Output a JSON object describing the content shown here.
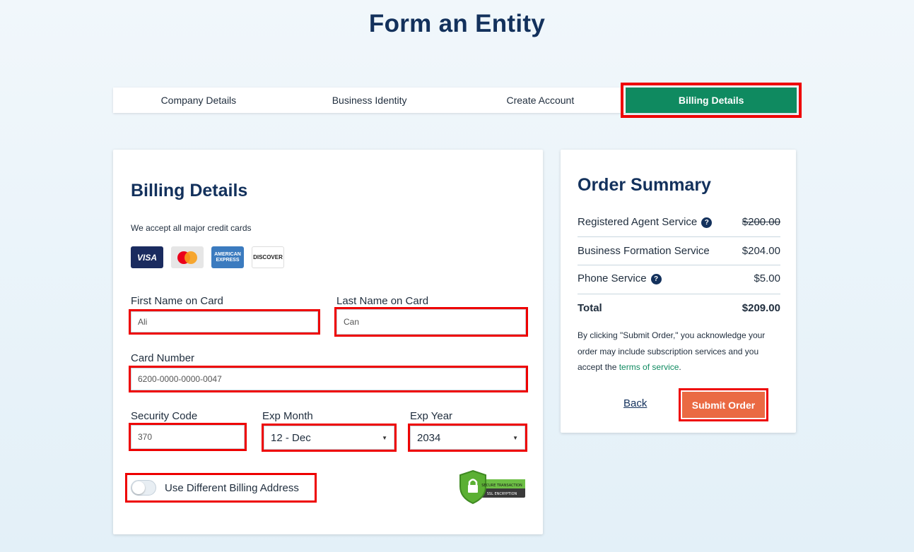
{
  "page": {
    "title": "Form an Entity"
  },
  "steps": [
    {
      "label": "Company Details"
    },
    {
      "label": "Business Identity"
    },
    {
      "label": "Create Account"
    },
    {
      "label": "Billing Details"
    }
  ],
  "billing": {
    "heading": "Billing Details",
    "accept_text": "We accept all major credit cards",
    "card_logos": {
      "visa": "VISA",
      "amex": "AMERICAN EXPRESS",
      "discover": "DISCOVER"
    },
    "first_name": {
      "label": "First Name on Card",
      "value": "Ali"
    },
    "last_name": {
      "label": "Last Name on Card",
      "value": "Can"
    },
    "card_number": {
      "label": "Card Number",
      "value": "6200-0000-0000-0047"
    },
    "security_code": {
      "label": "Security Code",
      "value": "370"
    },
    "exp_month": {
      "label": "Exp Month",
      "value": "12 - Dec"
    },
    "exp_year": {
      "label": "Exp Year",
      "value": "2034"
    },
    "toggle_label": "Use Different Billing Address",
    "ssl_badge": {
      "line1": "SECURE TRANSACTION",
      "line2": "SSL ENCRYPTION"
    }
  },
  "summary": {
    "heading": "Order Summary",
    "items": [
      {
        "label": "Registered Agent Service",
        "price": "$200.00",
        "has_help": true,
        "strikethrough": true
      },
      {
        "label": "Business Formation Service",
        "price": "$204.00",
        "has_help": false,
        "strikethrough": false
      },
      {
        "label": "Phone Service",
        "price": "$5.00",
        "has_help": true,
        "strikethrough": false
      }
    ],
    "total_label": "Total",
    "total_value": "$209.00",
    "disclaimer_before": "By clicking \"Submit Order,\" you acknowledge your order may include subscription services and you accept the ",
    "terms_link": "terms of service",
    "disclaimer_after": ".",
    "back_label": "Back",
    "submit_label": "Submit Order"
  },
  "colors": {
    "brand_navy": "#13315c",
    "active_step": "#0f8a60",
    "submit": "#ea6a43",
    "highlight": "#ee0000"
  }
}
